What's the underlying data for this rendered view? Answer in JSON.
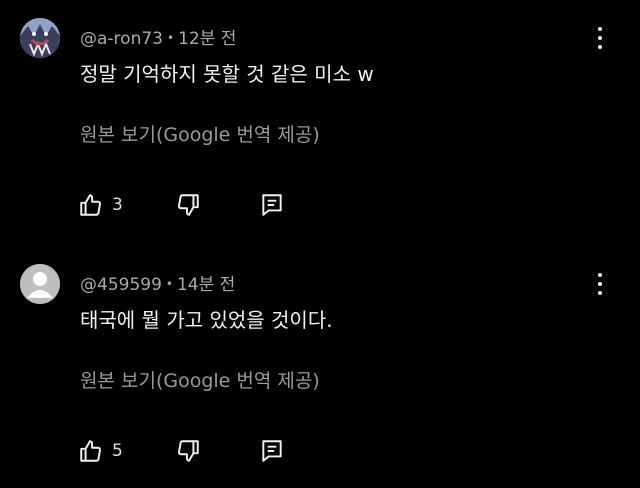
{
  "comments": [
    {
      "author": "@a-ron73",
      "time": "12분 전",
      "text": "정말 기억하지 못할 것 같은 미소 w",
      "translate_label": "원본 보기(Google 번역 제공)",
      "likes": "3",
      "avatar": "drawn-face-avatar"
    },
    {
      "author": "@459599",
      "time": "14분 전",
      "text": "태국에 뭘 가고 있었을 것이다.",
      "translate_label": "원본 보기(Google 번역 제공)",
      "likes": "5",
      "avatar": "default-person-avatar"
    }
  ],
  "colors": {
    "background": "#000000",
    "text": "#f1f1f1",
    "meta": "#aaaaaa",
    "translate": "#9a9a9a"
  }
}
